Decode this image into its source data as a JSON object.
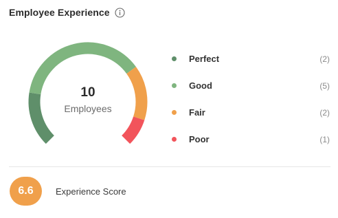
{
  "header": {
    "title": "Employee Experience",
    "info_icon": "info-icon"
  },
  "gauge": {
    "count": "10",
    "label": "Employees"
  },
  "legend": [
    {
      "label": "Perfect",
      "count": "(2)",
      "value": 2,
      "color": "#5f8f6a"
    },
    {
      "label": "Good",
      "count": "(5)",
      "value": 5,
      "color": "#7fb57f"
    },
    {
      "label": "Fair",
      "count": "(2)",
      "value": 2,
      "color": "#f0a04b"
    },
    {
      "label": "Poor",
      "count": "(1)",
      "value": 1,
      "color": "#f2545b"
    }
  ],
  "score": {
    "value": "6.6",
    "label": "Experience Score",
    "color": "#f0a04b"
  }
}
